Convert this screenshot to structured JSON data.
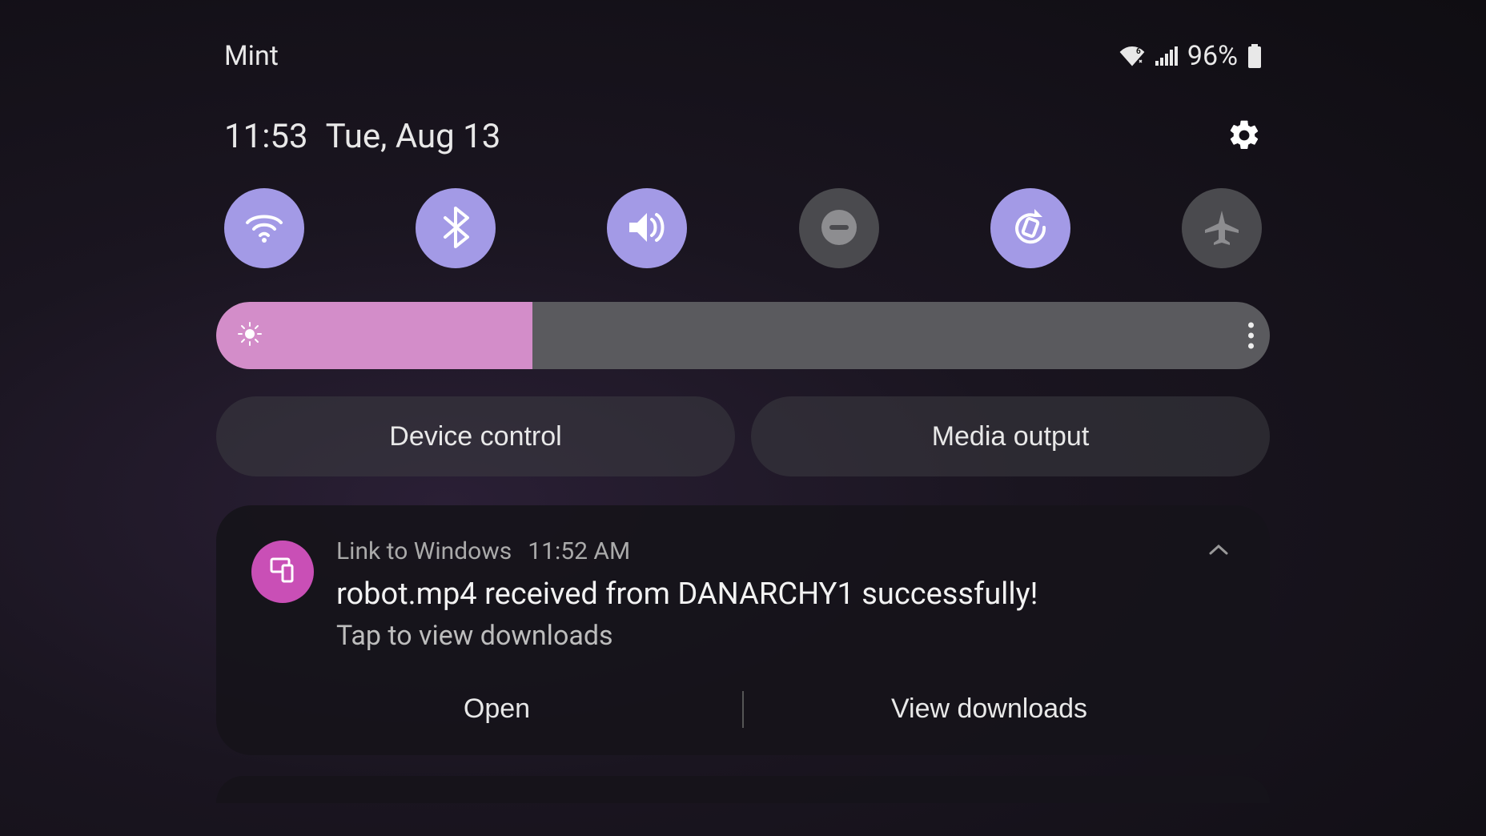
{
  "status": {
    "carrier": "Mint",
    "battery_pct": "96%",
    "wifi_band": "6"
  },
  "datetime": {
    "time": "11:53",
    "date": "Tue, Aug 13"
  },
  "quick_settings": [
    {
      "name": "wifi",
      "active": true
    },
    {
      "name": "bluetooth",
      "active": true
    },
    {
      "name": "sound",
      "active": true
    },
    {
      "name": "dnd",
      "active": false
    },
    {
      "name": "auto-rotate",
      "active": true
    },
    {
      "name": "airplane",
      "active": false
    }
  ],
  "brightness": {
    "percent": 30
  },
  "pills": {
    "device_control": "Device control",
    "media_output": "Media output"
  },
  "notification": {
    "app": "Link to Windows",
    "time": "11:52 AM",
    "title": "robot.mp4 received from DANARCHY1 successfully!",
    "subtitle": "Tap to view downloads",
    "actions": {
      "open": "Open",
      "view_downloads": "View downloads"
    }
  },
  "colors": {
    "toggle_active": "#A39AE6",
    "toggle_inactive": "#4a4a4e",
    "brightness_fill": "#D38DC9",
    "app_badge": "#C94FB6"
  }
}
